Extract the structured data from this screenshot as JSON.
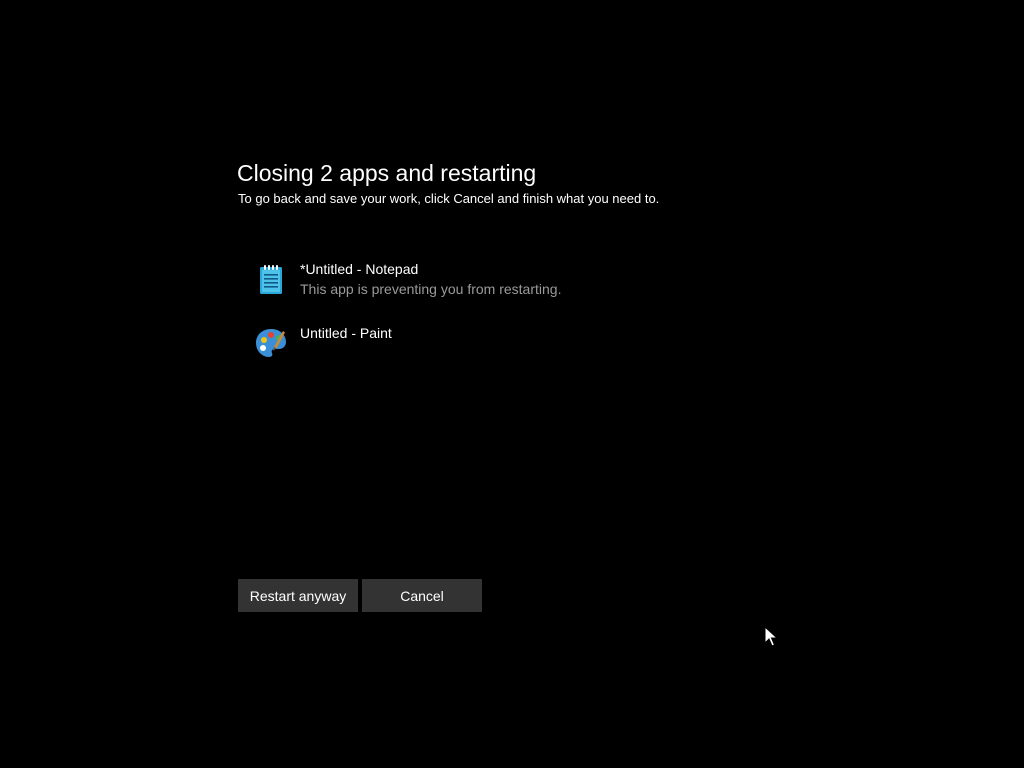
{
  "header": {
    "title": "Closing 2 apps and restarting",
    "subtitle": "To go back and save your work, click Cancel and finish what you need to."
  },
  "apps": [
    {
      "name": "*Untitled - Notepad",
      "status": "This app is preventing you from restarting.",
      "icon": "notepad-icon"
    },
    {
      "name": "Untitled - Paint",
      "status": "",
      "icon": "paint-icon"
    }
  ],
  "actions": {
    "restart_label": "Restart anyway",
    "cancel_label": "Cancel"
  },
  "colors": {
    "background": "#000000",
    "text": "#ffffff",
    "secondary_text": "#9a9a9a",
    "button": "#333333",
    "notepad_icon": "#29a8d8",
    "paint_icon": "#3a8fd6"
  }
}
